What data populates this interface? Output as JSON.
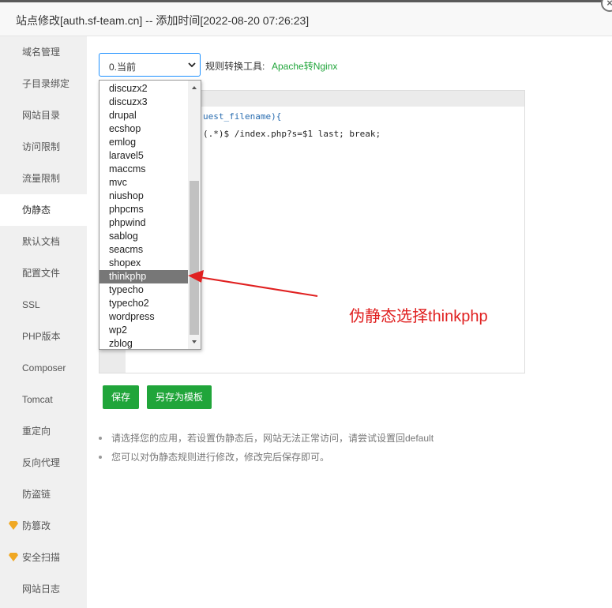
{
  "window": {
    "title": "站点修改[auth.sf-team.cn] -- 添加时间[2022-08-20 07:26:23]",
    "close_symbol": "×"
  },
  "sidebar": {
    "items": [
      {
        "label": "域名管理",
        "icon": ""
      },
      {
        "label": "子目录绑定",
        "icon": ""
      },
      {
        "label": "网站目录",
        "icon": ""
      },
      {
        "label": "访问限制",
        "icon": ""
      },
      {
        "label": "流量限制",
        "icon": ""
      },
      {
        "label": "伪静态",
        "icon": "",
        "active": true
      },
      {
        "label": "默认文档",
        "icon": ""
      },
      {
        "label": "配置文件",
        "icon": ""
      },
      {
        "label": "SSL",
        "icon": ""
      },
      {
        "label": "PHP版本",
        "icon": ""
      },
      {
        "label": "Composer",
        "icon": ""
      },
      {
        "label": "Tomcat",
        "icon": ""
      },
      {
        "label": "重定向",
        "icon": ""
      },
      {
        "label": "反向代理",
        "icon": ""
      },
      {
        "label": "防盗链",
        "icon": ""
      },
      {
        "label": "防篡改",
        "icon": "diamond-icon"
      },
      {
        "label": "安全扫描",
        "icon": "diamond-icon"
      },
      {
        "label": "网站日志",
        "icon": ""
      }
    ]
  },
  "rewrite": {
    "select_value": "0.当前",
    "tool_label": "规则转换工具:",
    "tool_link": "Apache转Nginx",
    "options": [
      "discuzx2",
      "discuzx3",
      "drupal",
      "ecshop",
      "emlog",
      "laravel5",
      "maccms",
      "mvc",
      "niushop",
      "phpcms",
      "phpwind",
      "sablog",
      "seacms",
      "shopex",
      "thinkphp",
      "typecho",
      "typecho2",
      "wordpress",
      "wp2",
      "zblog"
    ],
    "selected_option": "thinkphp",
    "code_line1": "uest_filename){",
    "code_line2": "(.*)$  /index.php?s=$1  last;   break;"
  },
  "buttons": {
    "save": "保存",
    "save_as_template": "另存为模板"
  },
  "tips": [
    "请选择您的应用，若设置伪静态后，网站无法正常访问，请尝试设置回default",
    "您可以对伪静态规则进行修改，修改完后保存即可。"
  ],
  "annotation": {
    "text": "伪静态选择thinkphp",
    "color": "#e02020"
  },
  "colors": {
    "accent_green": "#20a53a",
    "focus_blue": "#1e90ff"
  }
}
